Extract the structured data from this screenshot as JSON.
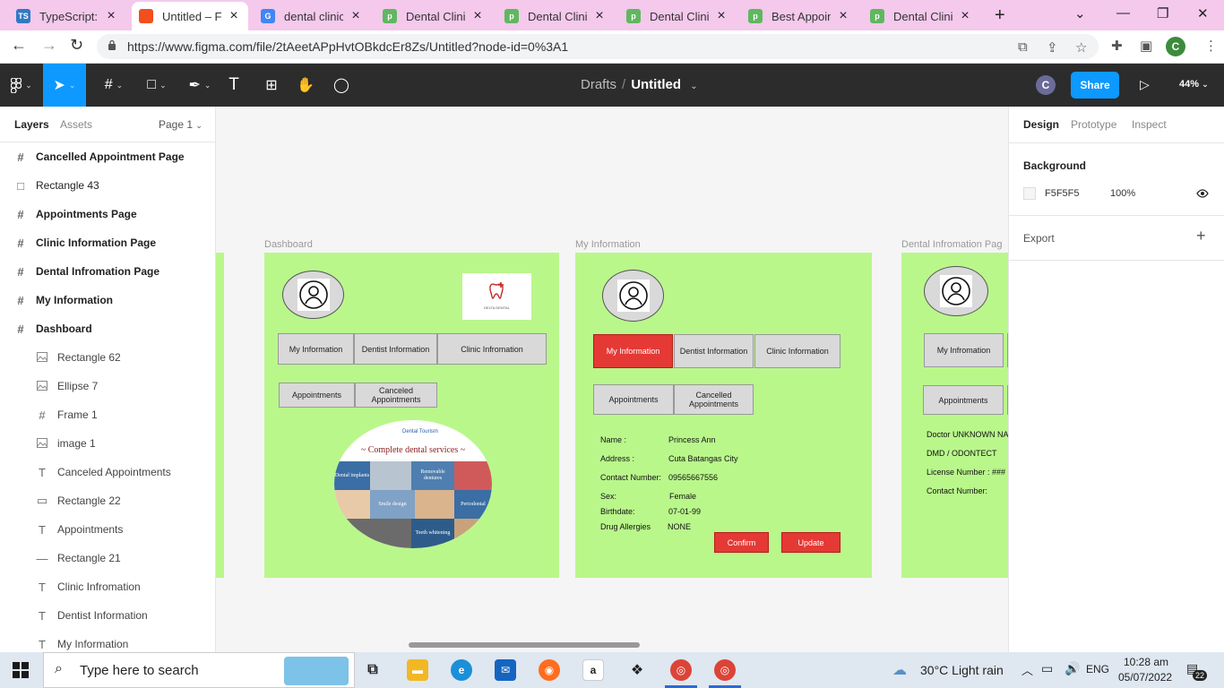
{
  "browser": {
    "tabs": [
      {
        "title": "TypeScript: TS",
        "fav_text": "TS",
        "fav_color": "#3178c6"
      },
      {
        "title": "Untitled – Fig",
        "fav_text": "",
        "fav_color": "#f24e1e"
      },
      {
        "title": "dental clinic -",
        "fav_text": "G",
        "fav_color": "#4285f4"
      },
      {
        "title": "Dental Clinic",
        "fav_text": "p",
        "fav_color": "#5fb85f"
      },
      {
        "title": "Dental Clinic",
        "fav_text": "p",
        "fav_color": "#5fb85f"
      },
      {
        "title": "Dental Clinic",
        "fav_text": "p",
        "fav_color": "#5fb85f"
      },
      {
        "title": "Best Appoint",
        "fav_text": "p",
        "fav_color": "#5fb85f"
      },
      {
        "title": "Dental Clinic",
        "fav_text": "p",
        "fav_color": "#5fb85f"
      }
    ],
    "url": "https://www.figma.com/file/2tAeetAPpHvtOBkdcEr8Zs/Untitled?node-id=0%3A1",
    "profile_initial": "C"
  },
  "figma": {
    "breadcrumb_drafts": "Drafts",
    "breadcrumb_sep": "/",
    "file_name": "Untitled",
    "user_initial": "C",
    "share_label": "Share",
    "zoom": "44%",
    "accent": "#0d99ff"
  },
  "layers_panel": {
    "tab_layers": "Layers",
    "tab_assets": "Assets",
    "page_selector": "Page 1",
    "items": [
      {
        "label": "Cancelled Appointment Page",
        "icon": "#",
        "level": "top"
      },
      {
        "label": "Rectangle 43",
        "icon": "□",
        "level": "top-plain"
      },
      {
        "label": "Appointments Page",
        "icon": "#",
        "level": "top"
      },
      {
        "label": "Clinic Information Page",
        "icon": "#",
        "level": "top"
      },
      {
        "label": "Dental Infromation Page",
        "icon": "#",
        "level": "top"
      },
      {
        "label": "My Information",
        "icon": "#",
        "level": "top"
      },
      {
        "label": "Dashboard",
        "icon": "#",
        "level": "top"
      },
      {
        "label": "Rectangle 62",
        "icon": "img",
        "level": "child"
      },
      {
        "label": "Ellipse 7",
        "icon": "img",
        "level": "child"
      },
      {
        "label": "Frame 1",
        "icon": "#",
        "level": "child"
      },
      {
        "label": "image 1",
        "icon": "img",
        "level": "child"
      },
      {
        "label": "Canceled Appointments",
        "icon": "T",
        "level": "child"
      },
      {
        "label": "Rectangle 22",
        "icon": "▭",
        "level": "child"
      },
      {
        "label": "Appointments",
        "icon": "T",
        "level": "child"
      },
      {
        "label": "Rectangle 21",
        "icon": "—",
        "level": "child"
      },
      {
        "label": "Clinic Infromation",
        "icon": "T",
        "level": "child"
      },
      {
        "label": "Dentist Information",
        "icon": "T",
        "level": "child"
      },
      {
        "label": "My Information",
        "icon": "T",
        "level": "child"
      }
    ]
  },
  "canvas": {
    "background": "#f5f5f5",
    "frame_color": "#b9f78b",
    "dashboard": {
      "label": "Dashboard",
      "btn_my_info": "My Information",
      "btn_dentist_info": "Dentist Information",
      "btn_clinic_info": "Clinic Infromation",
      "btn_appointments": "Appointments",
      "btn_canceled": "Canceled Appointments",
      "logo_caption": "DELTA DENTAL",
      "collage_title": "~ Complete dental services ~",
      "collage_brand": "Dental Tourism",
      "tiles": [
        "Dental implants",
        "Removable dentures",
        "Smile design",
        "Periodontal",
        "Teeth whitening"
      ]
    },
    "my_information": {
      "label": "My Information",
      "btn_my_info": "My Information",
      "btn_dentist_info": "Dentist Information",
      "btn_clinic_info": "Clinic Information",
      "btn_appointments": "Appointments",
      "btn_cancelled": "Cancelled Appointments",
      "fields": [
        {
          "k": "Name :",
          "v": "Princess Ann"
        },
        {
          "k": "Address :",
          "v": "Cuta Batangas City"
        },
        {
          "k": "Contact Number:",
          "v": "09565667556"
        },
        {
          "k": "Sex:",
          "v": "Female"
        },
        {
          "k": "Birthdate:",
          "v": "07-01-99"
        },
        {
          "k": "Drug Allergies",
          "v": "NONE"
        }
      ],
      "btn_confirm": "Confirm",
      "btn_update": "Update"
    },
    "dental_info": {
      "label": "Dental Infromation Pag",
      "btn_my_info": "My Infromation",
      "btn_appointments": "Appointments",
      "lines": [
        "Doctor UNKNOWN NA",
        "DMD / ODONTECT",
        "License Number : ###",
        "Contact Number:"
      ]
    }
  },
  "right_panel": {
    "tab_design": "Design",
    "tab_prototype": "Prototype",
    "tab_inspect": "Inspect",
    "background_title": "Background",
    "bg_hex": "F5F5F5",
    "bg_opacity": "100%",
    "export_title": "Export"
  },
  "help_label": "?",
  "taskbar": {
    "search_placeholder": "Type here to search",
    "weather": "30°C  Light rain",
    "lang": "ENG",
    "time": "10:28 am",
    "date": "05/07/2022",
    "notif_count": "22"
  }
}
